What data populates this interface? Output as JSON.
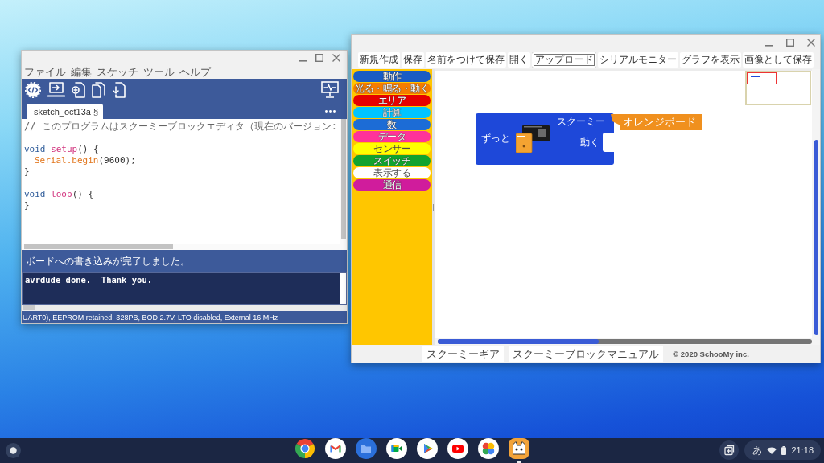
{
  "code_window": {
    "menu": [
      "ファイル",
      "編集",
      "スケッチ",
      "ツール",
      "ヘルプ"
    ],
    "tabs": [
      {
        "label": "sketch_oct13a §",
        "selected": true
      }
    ],
    "code_lines": [
      {
        "kind": "code",
        "indented": false,
        "segments": [
          {
            "kind": "comment",
            "text": "// このプログラムはスクーミーブロックエディタ（現在のバージョン:"
          }
        ]
      },
      {
        "kind": "blank"
      },
      {
        "kind": "code",
        "indented": false,
        "segments": [
          {
            "kind": "keyword",
            "text": "void "
          },
          {
            "kind": "function",
            "text": "setup"
          },
          {
            "kind": "plain",
            "text": "() {"
          }
        ]
      },
      {
        "kind": "code",
        "indented": true,
        "segments": [
          {
            "kind": "builtin",
            "text": "Serial.begin"
          },
          {
            "kind": "plain",
            "text": "(9600);"
          }
        ]
      },
      {
        "kind": "code",
        "indented": false,
        "segments": [
          {
            "kind": "plain",
            "text": "}"
          }
        ]
      },
      {
        "kind": "blank"
      },
      {
        "kind": "code",
        "indented": false,
        "segments": [
          {
            "kind": "keyword",
            "text": "void "
          },
          {
            "kind": "function",
            "text": "loop"
          },
          {
            "kind": "plain",
            "text": "() {"
          }
        ]
      },
      {
        "kind": "code",
        "indented": false,
        "segments": [
          {
            "kind": "plain",
            "text": "}"
          }
        ]
      }
    ],
    "status_message": "ボードへの書き込みが完了しました。",
    "console_lines": [
      "avrdude done.  Thank you."
    ],
    "board_info": "UART0), EEPROM retained, 328PB, BOD 2.7V, LTO disabled, External 16 MHz"
  },
  "block_window": {
    "toolbar": [
      {
        "label": "新規作成",
        "focused": false
      },
      {
        "label": "保存",
        "focused": false
      },
      {
        "label": "名前をつけて保存",
        "focused": false
      },
      {
        "label": "開く",
        "focused": false
      },
      {
        "label": "アップロード",
        "focused": true
      },
      {
        "label": "シリアルモニター",
        "focused": false
      },
      {
        "label": "グラフを表示",
        "focused": false
      },
      {
        "label": "画像として保存",
        "focused": false
      }
    ],
    "palette": [
      {
        "label": "動作",
        "color": "#1a5cc4"
      },
      {
        "label": "光る・鳴る・動く",
        "color": "#f57c00"
      },
      {
        "label": "エリア",
        "color": "#e60000"
      },
      {
        "label": "計算",
        "color": "#00c4ff"
      },
      {
        "label": "数",
        "color": "#1c6cd6"
      },
      {
        "label": "データ",
        "color": "#ff3399"
      },
      {
        "label": "センサー",
        "color": "#ffff00"
      },
      {
        "label": "スイッチ",
        "color": "#12a32e"
      },
      {
        "label": "表示する",
        "color": "#ffffff"
      },
      {
        "label": "通信",
        "color": "#d01c9c"
      }
    ],
    "forever_block": {
      "label": "ずっと",
      "device": "スクーミー",
      "action": "動く",
      "value": "オレンジボード"
    },
    "footer": {
      "links": [
        "スクーミーギア",
        "スクーミーブロックマニュアル"
      ],
      "copyright": "© 2020 SchooMy inc."
    }
  },
  "taskbar": {
    "apps": [
      {
        "kind": "browser",
        "active": false
      },
      {
        "kind": "mail",
        "active": false
      },
      {
        "kind": "files",
        "active": false
      },
      {
        "kind": "meet",
        "active": false
      },
      {
        "kind": "play",
        "active": false
      },
      {
        "kind": "youtube",
        "active": false
      },
      {
        "kind": "photos",
        "active": false
      },
      {
        "kind": "cat",
        "active": true
      }
    ],
    "ime": "あ",
    "time": "21:18"
  }
}
